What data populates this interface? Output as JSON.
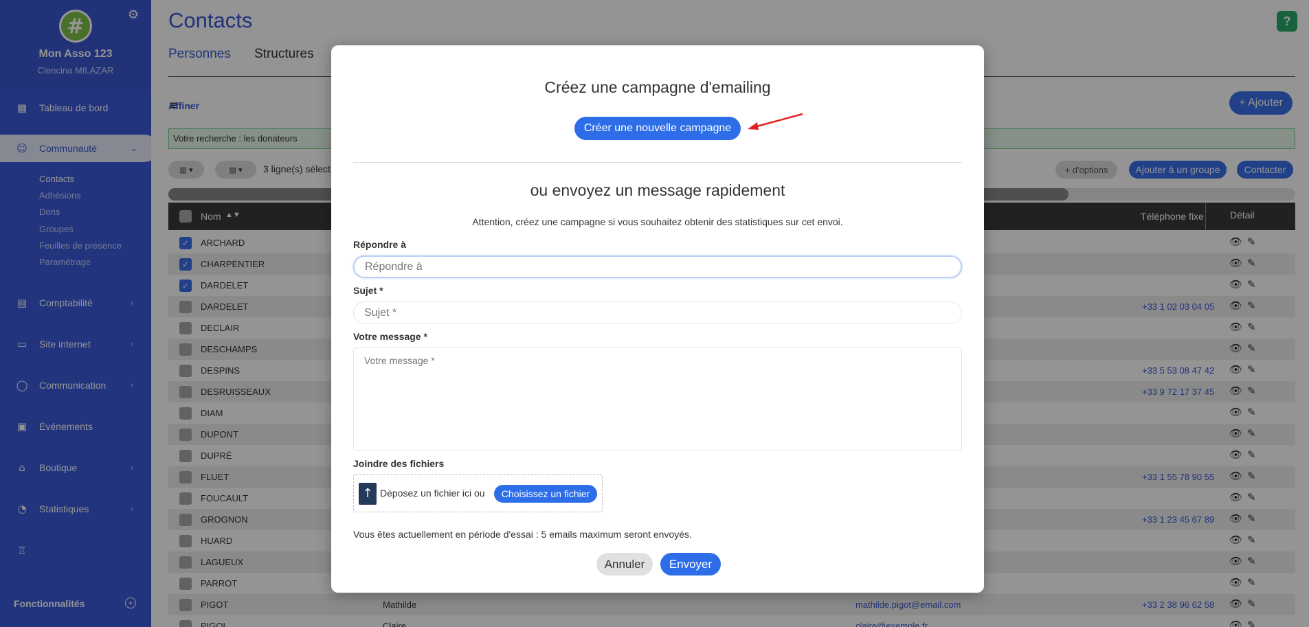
{
  "sidebar": {
    "org_name": "Mon Asso 123",
    "user_name": "Clencina MILAZAR",
    "logo_glyph": "#",
    "nav": [
      {
        "label": "Tableau de bord",
        "icon": "dashboard-icon"
      },
      {
        "label": "Communauté",
        "icon": "community-icon"
      },
      {
        "label": "Comptabilité",
        "icon": "accounting-icon"
      },
      {
        "label": "Site internet",
        "icon": "website-icon"
      },
      {
        "label": "Communication",
        "icon": "chat-icon"
      },
      {
        "label": "Événements",
        "icon": "calendar-icon"
      },
      {
        "label": "Boutique",
        "icon": "shop-icon"
      },
      {
        "label": "Statistiques",
        "icon": "stats-icon"
      }
    ],
    "sub_items": [
      "Contacts",
      "Adhésions",
      "Dons",
      "Groupes",
      "Feuilles de présence",
      "Paramétrage"
    ],
    "features_label": "Fonctionnalités"
  },
  "main": {
    "title": "Contacts",
    "tabs": [
      "Personnes",
      "Structures"
    ],
    "help": "?",
    "affiner": "Affiner",
    "ajouter": "+ Ajouter",
    "search_text": "Votre recherche : les donateurs",
    "selected_count": "3 ligne(s) sélect",
    "more_options": "+ d'options",
    "add_group": "Ajouter à un groupe",
    "contact": "Contacter",
    "columns": {
      "nom": "Nom",
      "telephone": "Téléphone fixe",
      "detail": "Détail"
    },
    "rows": [
      {
        "name": "ARCHARD",
        "checked": true,
        "phone": "",
        "first": "",
        "email": ""
      },
      {
        "name": "CHARPENTIER",
        "checked": true,
        "phone": "",
        "first": "",
        "email": ""
      },
      {
        "name": "DARDELET",
        "checked": true,
        "phone": "",
        "first": "",
        "email": ""
      },
      {
        "name": "DARDELET",
        "checked": false,
        "phone": "+33 1 02 03 04 05",
        "first": "",
        "email": ""
      },
      {
        "name": "DECLAIR",
        "checked": false,
        "phone": "",
        "first": "",
        "email": ""
      },
      {
        "name": "DESCHAMPS",
        "checked": false,
        "phone": "",
        "first": "",
        "email": ""
      },
      {
        "name": "DESPINS",
        "checked": false,
        "phone": "+33 5 53 08 47 42",
        "first": "",
        "email": ""
      },
      {
        "name": "DESRUISSEAUX",
        "checked": false,
        "phone": "+33 9 72 17 37 45",
        "first": "",
        "email": ""
      },
      {
        "name": "DIAM",
        "checked": false,
        "phone": "",
        "first": "",
        "email": ""
      },
      {
        "name": "DUPONT",
        "checked": false,
        "phone": "",
        "first": "",
        "email": ""
      },
      {
        "name": "DUPRÉ",
        "checked": false,
        "phone": "",
        "first": "",
        "email": ""
      },
      {
        "name": "FLUET",
        "checked": false,
        "phone": "+33 1 55 78 90 55",
        "first": "",
        "email": ""
      },
      {
        "name": "FOUCAULT",
        "checked": false,
        "phone": "",
        "first": "",
        "email": ""
      },
      {
        "name": "GROGNON",
        "checked": false,
        "phone": "+33 1 23 45 67 89",
        "first": "",
        "email": ""
      },
      {
        "name": "HUARD",
        "checked": false,
        "phone": "",
        "first": "",
        "email": ""
      },
      {
        "name": "LAGUEUX",
        "checked": false,
        "phone": "",
        "first": "",
        "email": ""
      },
      {
        "name": "PARROT",
        "checked": false,
        "phone": "",
        "first": "",
        "email": ""
      },
      {
        "name": "PIGOT",
        "checked": false,
        "phone": "+33 2 38 96 62 58",
        "first": "Mathilde",
        "email": "mathilde.pigot@email.com"
      },
      {
        "name": "PIGOL",
        "checked": false,
        "phone": "",
        "first": "Claire",
        "email": "claire@exemple.fr"
      }
    ]
  },
  "modal": {
    "title": "Créez une campagne d'emailing",
    "create_button": "Créer une nouvelle campagne",
    "subtitle": "ou envoyez un message rapidement",
    "note": "Attention, créez une campagne si vous souhaitez obtenir des statistiques sur cet envoi.",
    "reply_label": "Répondre à",
    "reply_placeholder": "Répondre à",
    "subject_label": "Sujet *",
    "subject_placeholder": "Sujet *",
    "message_label": "Votre message *",
    "message_placeholder": "Votre message *",
    "attach_label": "Joindre des fichiers",
    "drop_text": "Déposez un fichier ici ou",
    "choose_button": "Choisissez un fichier",
    "trial_note": "Vous êtes actuellement en période d'essai : 5 emails maximum seront envoyés.",
    "cancel": "Annuler",
    "send": "Envoyer"
  },
  "colors": {
    "accent": "#3a57cf",
    "primary": "#2d6ee8",
    "success": "#2aa86a",
    "arrow": "#e02020"
  }
}
